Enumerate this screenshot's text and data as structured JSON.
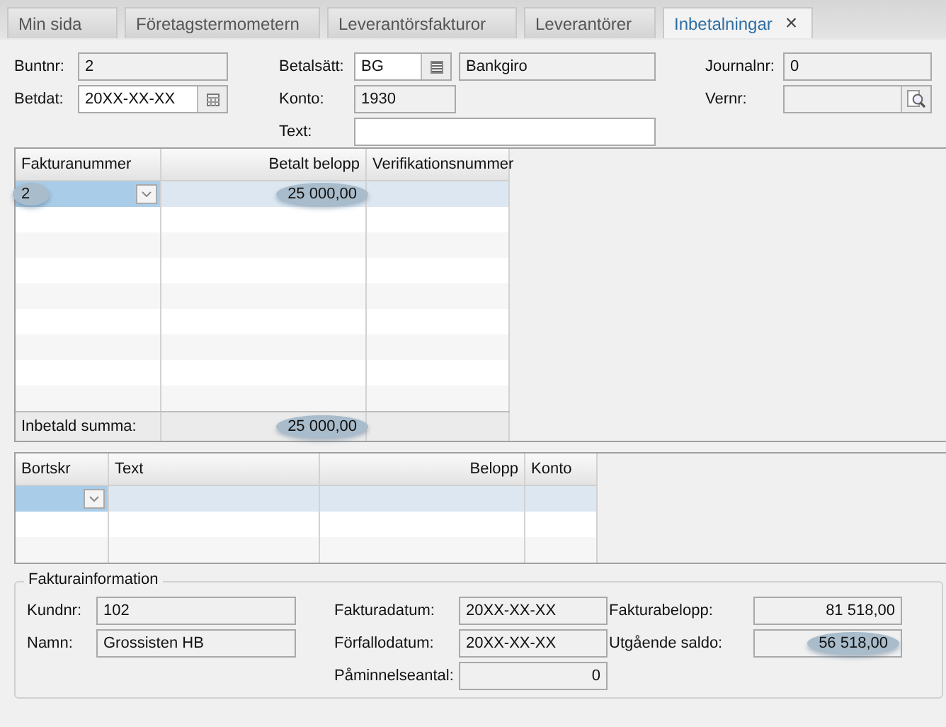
{
  "tabs": [
    {
      "label": "Min sida",
      "selected": false
    },
    {
      "label": "Företagstermometern",
      "selected": false
    },
    {
      "label": "Leverantörsfakturor",
      "selected": false
    },
    {
      "label": "Leverantörer",
      "selected": false
    },
    {
      "label": "Inbetalningar",
      "selected": true,
      "close": "×"
    }
  ],
  "header_form": [
    {
      "fields": [
        {
          "label": "Buntnr:",
          "value": "2",
          "kind": "text"
        },
        {
          "label": "Betdat:",
          "value": "20XX-XX-XX",
          "kind": "date"
        }
      ]
    },
    {
      "fields": [
        {
          "label": "Betalsätt:",
          "value": "BG",
          "kind": "list",
          "extra": "Bankgiro"
        },
        {
          "label": "Konto:",
          "value": "1930",
          "kind": "short"
        },
        {
          "label": "Text:",
          "kind": "wide"
        }
      ]
    },
    {
      "fields": [
        {
          "label": "Journalnr:",
          "value": "0",
          "kind": "text"
        },
        {
          "label": "Vernr:",
          "kind": "search"
        }
      ]
    }
  ],
  "invoice_table": {
    "columns": [
      "Fakturanummer",
      "Betalt belopp",
      "Verifikationsnummer"
    ],
    "rows": [
      {
        "selected": true,
        "cells": [
          {
            "text": "2",
            "highlighted": true
          },
          {
            "text": "25 000,00",
            "highlighted": true
          },
          {
            "highlighted": false
          }
        ]
      }
    ],
    "footer": {
      "label": "Inbetald summa:",
      "total": "25 000,00",
      "highlighted": true
    }
  },
  "writeoff_table": {
    "columns": [
      "Bortskr",
      "Text",
      "Belopp",
      "Konto"
    ],
    "rows": [
      {
        "selected": true
      },
      {
        "selected": false
      },
      {
        "selected": false
      }
    ]
  },
  "invoice_info": {
    "title": "Fakturainformation",
    "columns": [
      [
        {
          "label": "Kundnr:",
          "value": "102",
          "numeric": false,
          "highlighted": false
        },
        {
          "label": "Namn:",
          "value": "Grossisten HB",
          "numeric": false,
          "highlighted": false
        }
      ],
      [
        {
          "label": "Fakturadatum:",
          "value": "20XX-XX-XX",
          "numeric": false,
          "highlighted": false
        },
        {
          "label": "Förfallodatum:",
          "value": "20XX-XX-XX",
          "numeric": false,
          "highlighted": false
        },
        {
          "label": "Påminnelseantal:",
          "value": "0",
          "numeric": true,
          "highlighted": false
        }
      ],
      [
        {
          "label": "Fakturabelopp:",
          "value": "81 518,00",
          "numeric": true,
          "highlighted": false
        },
        {
          "label": "Utgående saldo:",
          "value": "56 518,00",
          "numeric": true,
          "highlighted": true
        }
      ]
    ]
  }
}
